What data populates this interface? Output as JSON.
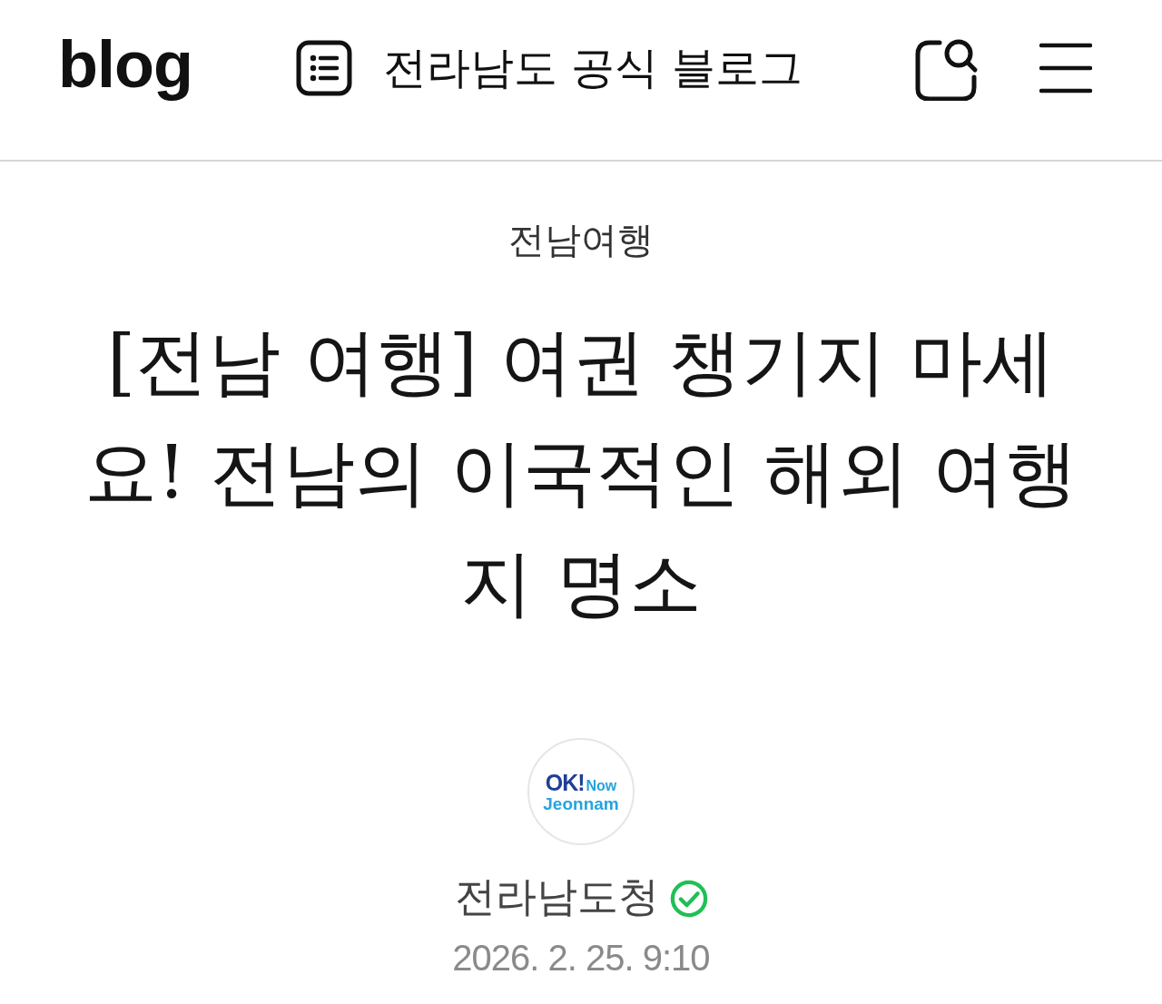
{
  "header": {
    "logo": "blog",
    "blog_title": "전라남도 공식 블로그"
  },
  "post": {
    "category": "전남여행",
    "title": "[전남 여행] 여권 챙기지 마세요! 전남의 이국적인 해외 여행지 명소"
  },
  "author": {
    "avatar_logo": {
      "line_1": "OK!",
      "line_1_small": "Now",
      "line_2": "Jeonnam"
    },
    "name": "전라남도청",
    "verified": true,
    "date": "2026. 2. 25. 9:10"
  }
}
